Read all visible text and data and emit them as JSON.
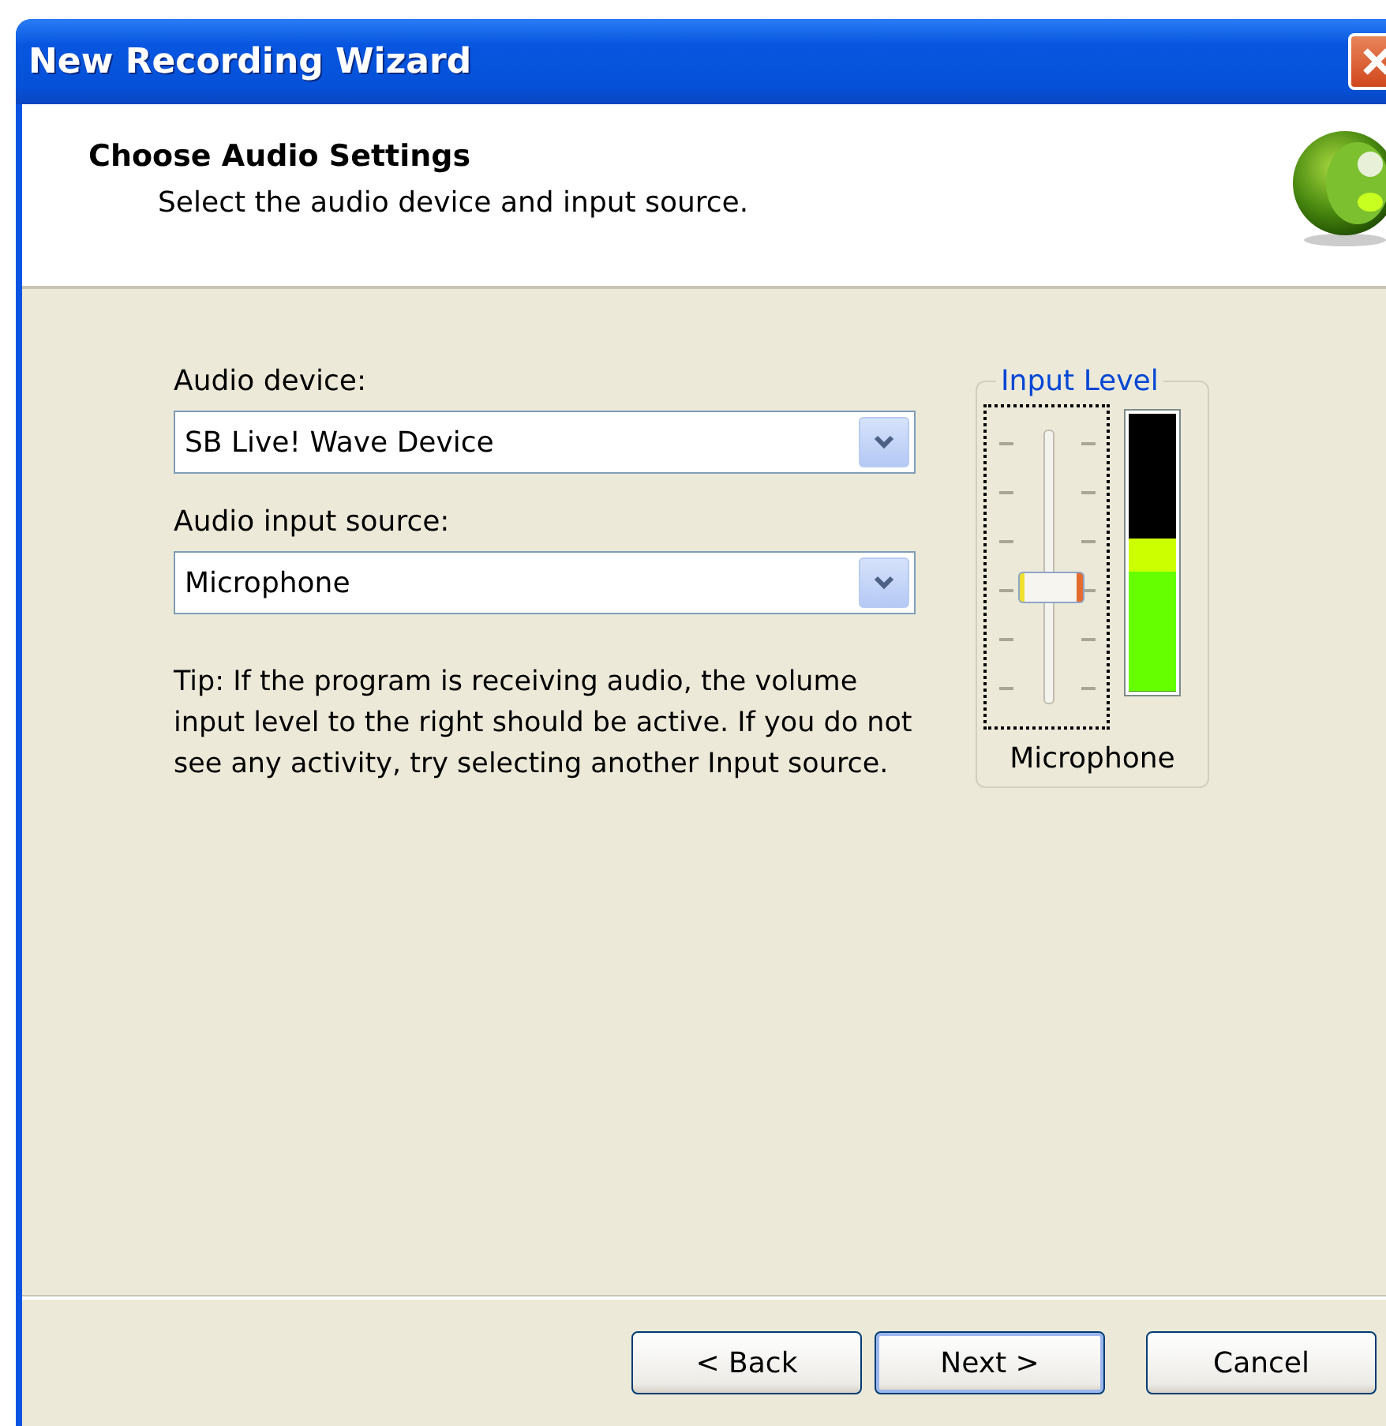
{
  "window": {
    "title": "New Recording Wizard"
  },
  "header": {
    "title": "Choose Audio Settings",
    "subtitle": "Select the audio device and input source."
  },
  "fields": [
    {
      "label": "Audio device:",
      "value": "SB Live! Wave Device"
    },
    {
      "label": "Audio input source:",
      "value": "Microphone"
    }
  ],
  "tip": "Tip: If the program is receiving audio, the volume input level to the right should be active.  If you do not see any activity, try selecting another Input source.",
  "input_level": {
    "title": "Input Level",
    "slider": {
      "level": 0.42
    },
    "meter": {
      "level": 0.55
    },
    "source": "Microphone"
  },
  "buttons": [
    {
      "label": "< Back",
      "kind": "back",
      "default": false
    },
    {
      "label": "Next >",
      "kind": "next",
      "default": true
    },
    {
      "label": "Cancel",
      "kind": "cancel",
      "default": false
    }
  ]
}
